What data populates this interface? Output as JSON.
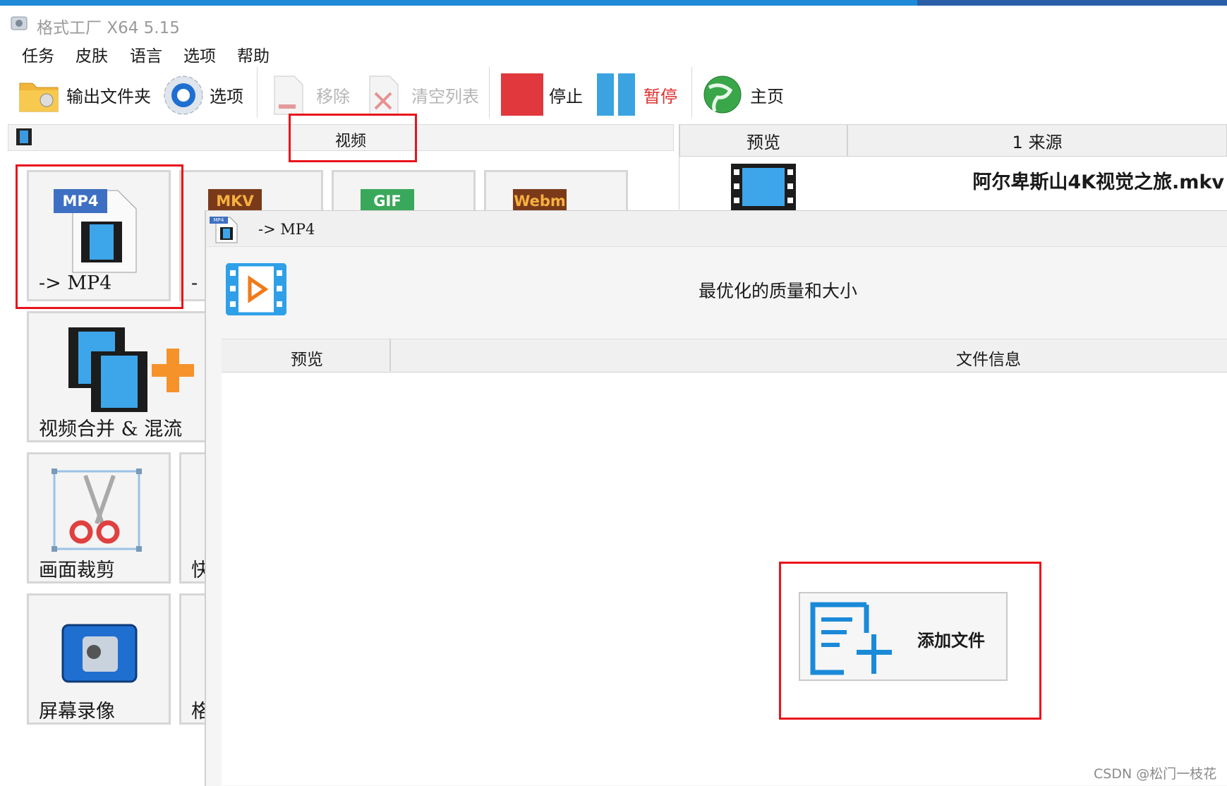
{
  "app": {
    "title": "格式工厂 X64 5.15"
  },
  "menu": {
    "items": [
      "任务",
      "皮肤",
      "语言",
      "选项",
      "帮助"
    ]
  },
  "toolbar": {
    "output_folder": "输出文件夹",
    "options": "选项",
    "remove": "移除",
    "clear_list": "清空列表",
    "stop": "停止",
    "pause": "暂停",
    "home": "主页"
  },
  "left": {
    "category_title": "视频",
    "tiles": {
      "mp4_badge": "MP4",
      "mp4_label": "-> MP4",
      "mkv_badge": "MKV",
      "gif_badge": "GIF",
      "webm_badge": "Webm",
      "second_label_fragment": "-",
      "merge_label": "视频合并 & 混流",
      "crop_label": "画面裁剪",
      "fast_fragment": "快",
      "record_label": "屏幕录像",
      "format_fragment": "格"
    }
  },
  "right": {
    "preview_header": "预览",
    "source_header": "1 来源",
    "source_file": "阿尔卑斯山4K视觉之旅.mkv"
  },
  "dialog": {
    "title": "-> MP4",
    "title_icon_badge": "MP4",
    "quality": "最优化的质量和大小",
    "preview_col": "预览",
    "info_col": "文件信息",
    "add_file": "添加文件"
  },
  "watermark": "CSDN @松门一枝花",
  "colors": {
    "highlight": "#e8141c",
    "accent_blue": "#1e8ad8",
    "pause_text": "#e03030"
  }
}
